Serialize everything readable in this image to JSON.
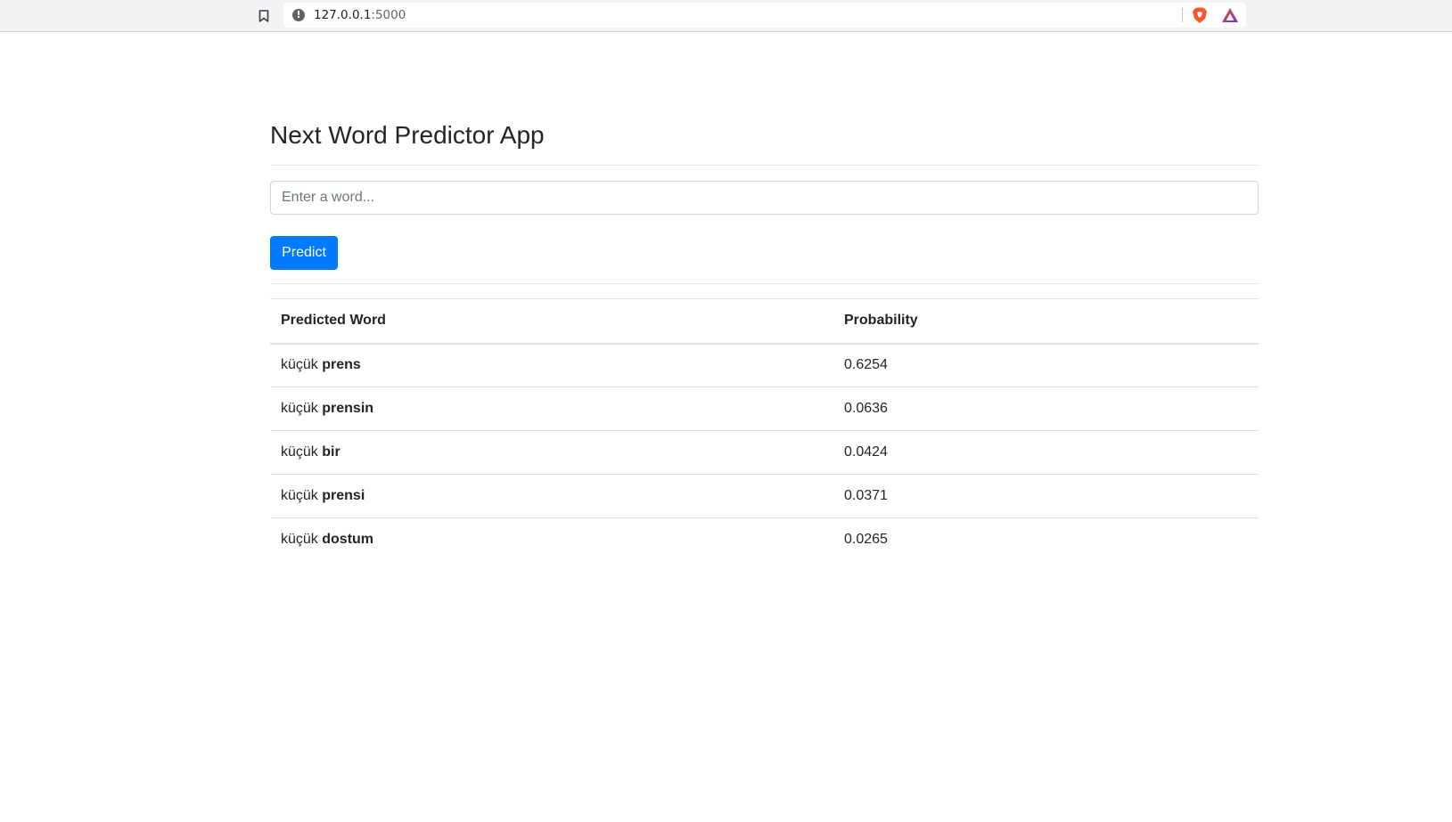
{
  "browser": {
    "url_host": "127.0.0.1",
    "url_port": ":5000",
    "info_glyph": "!"
  },
  "page": {
    "title": "Next Word Predictor App",
    "input": {
      "placeholder": "Enter a word...",
      "value": ""
    },
    "predict_label": "Predict",
    "table": {
      "headers": [
        "Predicted Word",
        "Probability"
      ],
      "rows": [
        {
          "prefix": "küçük",
          "word": "prens",
          "probability": "0.6254"
        },
        {
          "prefix": "küçük",
          "word": "prensin",
          "probability": "0.0636"
        },
        {
          "prefix": "küçük",
          "word": "bir",
          "probability": "0.0424"
        },
        {
          "prefix": "küçük",
          "word": "prensi",
          "probability": "0.0371"
        },
        {
          "prefix": "küçük",
          "word": "dostum",
          "probability": "0.0265"
        }
      ]
    }
  },
  "colors": {
    "primary_button": "#007bff",
    "brave_orange": "#fb542b",
    "rewards_purple": "#6b3ad1"
  }
}
